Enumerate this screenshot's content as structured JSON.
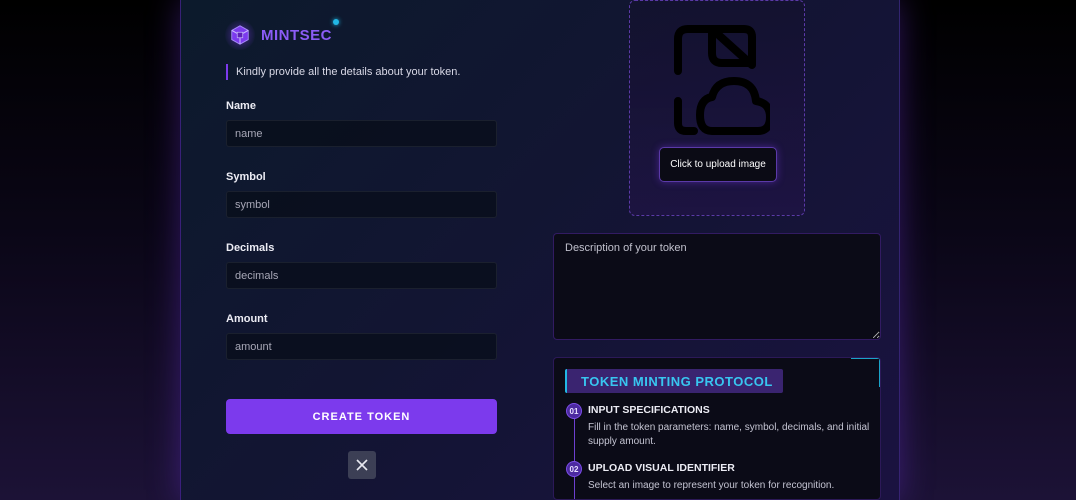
{
  "brand": {
    "name": "MINTSEC",
    "accent_color": "#7c3aed",
    "highlight_color": "#22b8e6"
  },
  "form": {
    "intro": "Kindly provide all the details about your token.",
    "fields": [
      {
        "label": "Name",
        "placeholder": "name",
        "value": ""
      },
      {
        "label": "Symbol",
        "placeholder": "symbol",
        "value": ""
      },
      {
        "label": "Decimals",
        "placeholder": "decimals",
        "value": ""
      },
      {
        "label": "Amount",
        "placeholder": "amount",
        "value": ""
      }
    ],
    "submit_label": "CREATE TOKEN",
    "close_icon": "close-icon"
  },
  "upload": {
    "icon": "file-cloud-upload-icon",
    "button_label": "Click to upload image"
  },
  "description": {
    "placeholder": "Description of your token",
    "value": ""
  },
  "protocol": {
    "title": "TOKEN MINTING PROTOCOL",
    "steps": [
      {
        "number": "01",
        "title": "INPUT SPECIFICATIONS",
        "description": "Fill in the token parameters: name, symbol, decimals, and initial supply amount."
      },
      {
        "number": "02",
        "title": "UPLOAD VISUAL IDENTIFIER",
        "description": "Select an image to represent your token for recognition."
      }
    ]
  }
}
